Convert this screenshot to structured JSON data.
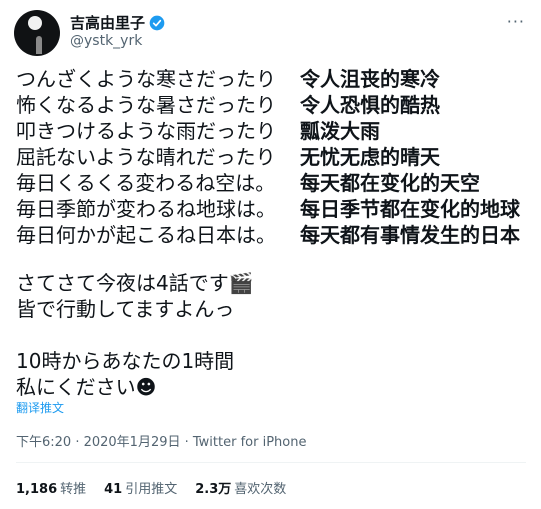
{
  "author": {
    "name": "吉高由里子",
    "handle": "@ystk_yrk"
  },
  "more_label": "···",
  "lines": [
    {
      "jp": "つんざくような寒さだったり",
      "cn": "令人沮丧的寒冷"
    },
    {
      "jp": "怖くなるような暑さだったり",
      "cn": "令人恐惧的酷热"
    },
    {
      "jp": "叩きつけるような雨だったり",
      "cn": "瓢泼大雨"
    },
    {
      "jp": "屈託ないような晴れだったり",
      "cn": "无忧无虑的晴天"
    },
    {
      "jp": "毎日くるくる変わるね空は。",
      "cn": "每天都在变化的天空"
    },
    {
      "jp": "毎日季節が変わるね地球は。",
      "cn": "每日季节都在变化的地球"
    },
    {
      "jp": "毎日何かが起こるね日本は。",
      "cn": "每天都有事情发生的日本"
    }
  ],
  "para2": [
    "さてさて今夜は4話です🎬",
    "皆で行動してますよんっ"
  ],
  "para3": [
    "10時からあなたの1時間",
    "私にください☻"
  ],
  "translate_label": "翻译推文",
  "meta": "下午6:20 · 2020年1月29日 · Twitter for iPhone",
  "stats": [
    {
      "count": "1,186",
      "label": "转推"
    },
    {
      "count": "41",
      "label": "引用推文"
    },
    {
      "count": "2.3万",
      "label": "喜欢次数"
    }
  ],
  "colors": {
    "verified": "#1d9bf0",
    "link": "#1d9bf0",
    "muted": "#536471"
  }
}
